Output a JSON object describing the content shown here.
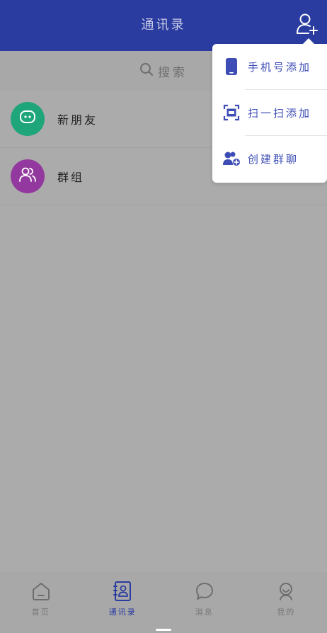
{
  "header": {
    "title": "通讯录",
    "add_icon": "add-contact-icon"
  },
  "search": {
    "placeholder": "搜索",
    "icon": "search-icon"
  },
  "contacts": {
    "items": [
      {
        "label": "新朋友",
        "icon": "chat-bubble-icon",
        "color": "#1ea57a"
      },
      {
        "label": "群组",
        "icon": "group-icon",
        "color": "#93389e"
      }
    ]
  },
  "menu": {
    "items": [
      {
        "label": "手机号添加",
        "icon": "phone-icon"
      },
      {
        "label": "扫一扫添加",
        "icon": "scan-icon"
      },
      {
        "label": "创建群聊",
        "icon": "create-group-icon"
      }
    ]
  },
  "tabs": {
    "active_index": 1,
    "active_color": "#2b3ca0",
    "items": [
      {
        "label": "首页",
        "icon": "home-icon"
      },
      {
        "label": "通讯录",
        "icon": "contacts-book-icon"
      },
      {
        "label": "消息",
        "icon": "message-icon"
      },
      {
        "label": "我的",
        "icon": "profile-icon"
      }
    ]
  },
  "colors": {
    "header_bg": "#2b3ca0",
    "overlay_bg": "#ababab",
    "menu_text": "#3d4db5"
  }
}
